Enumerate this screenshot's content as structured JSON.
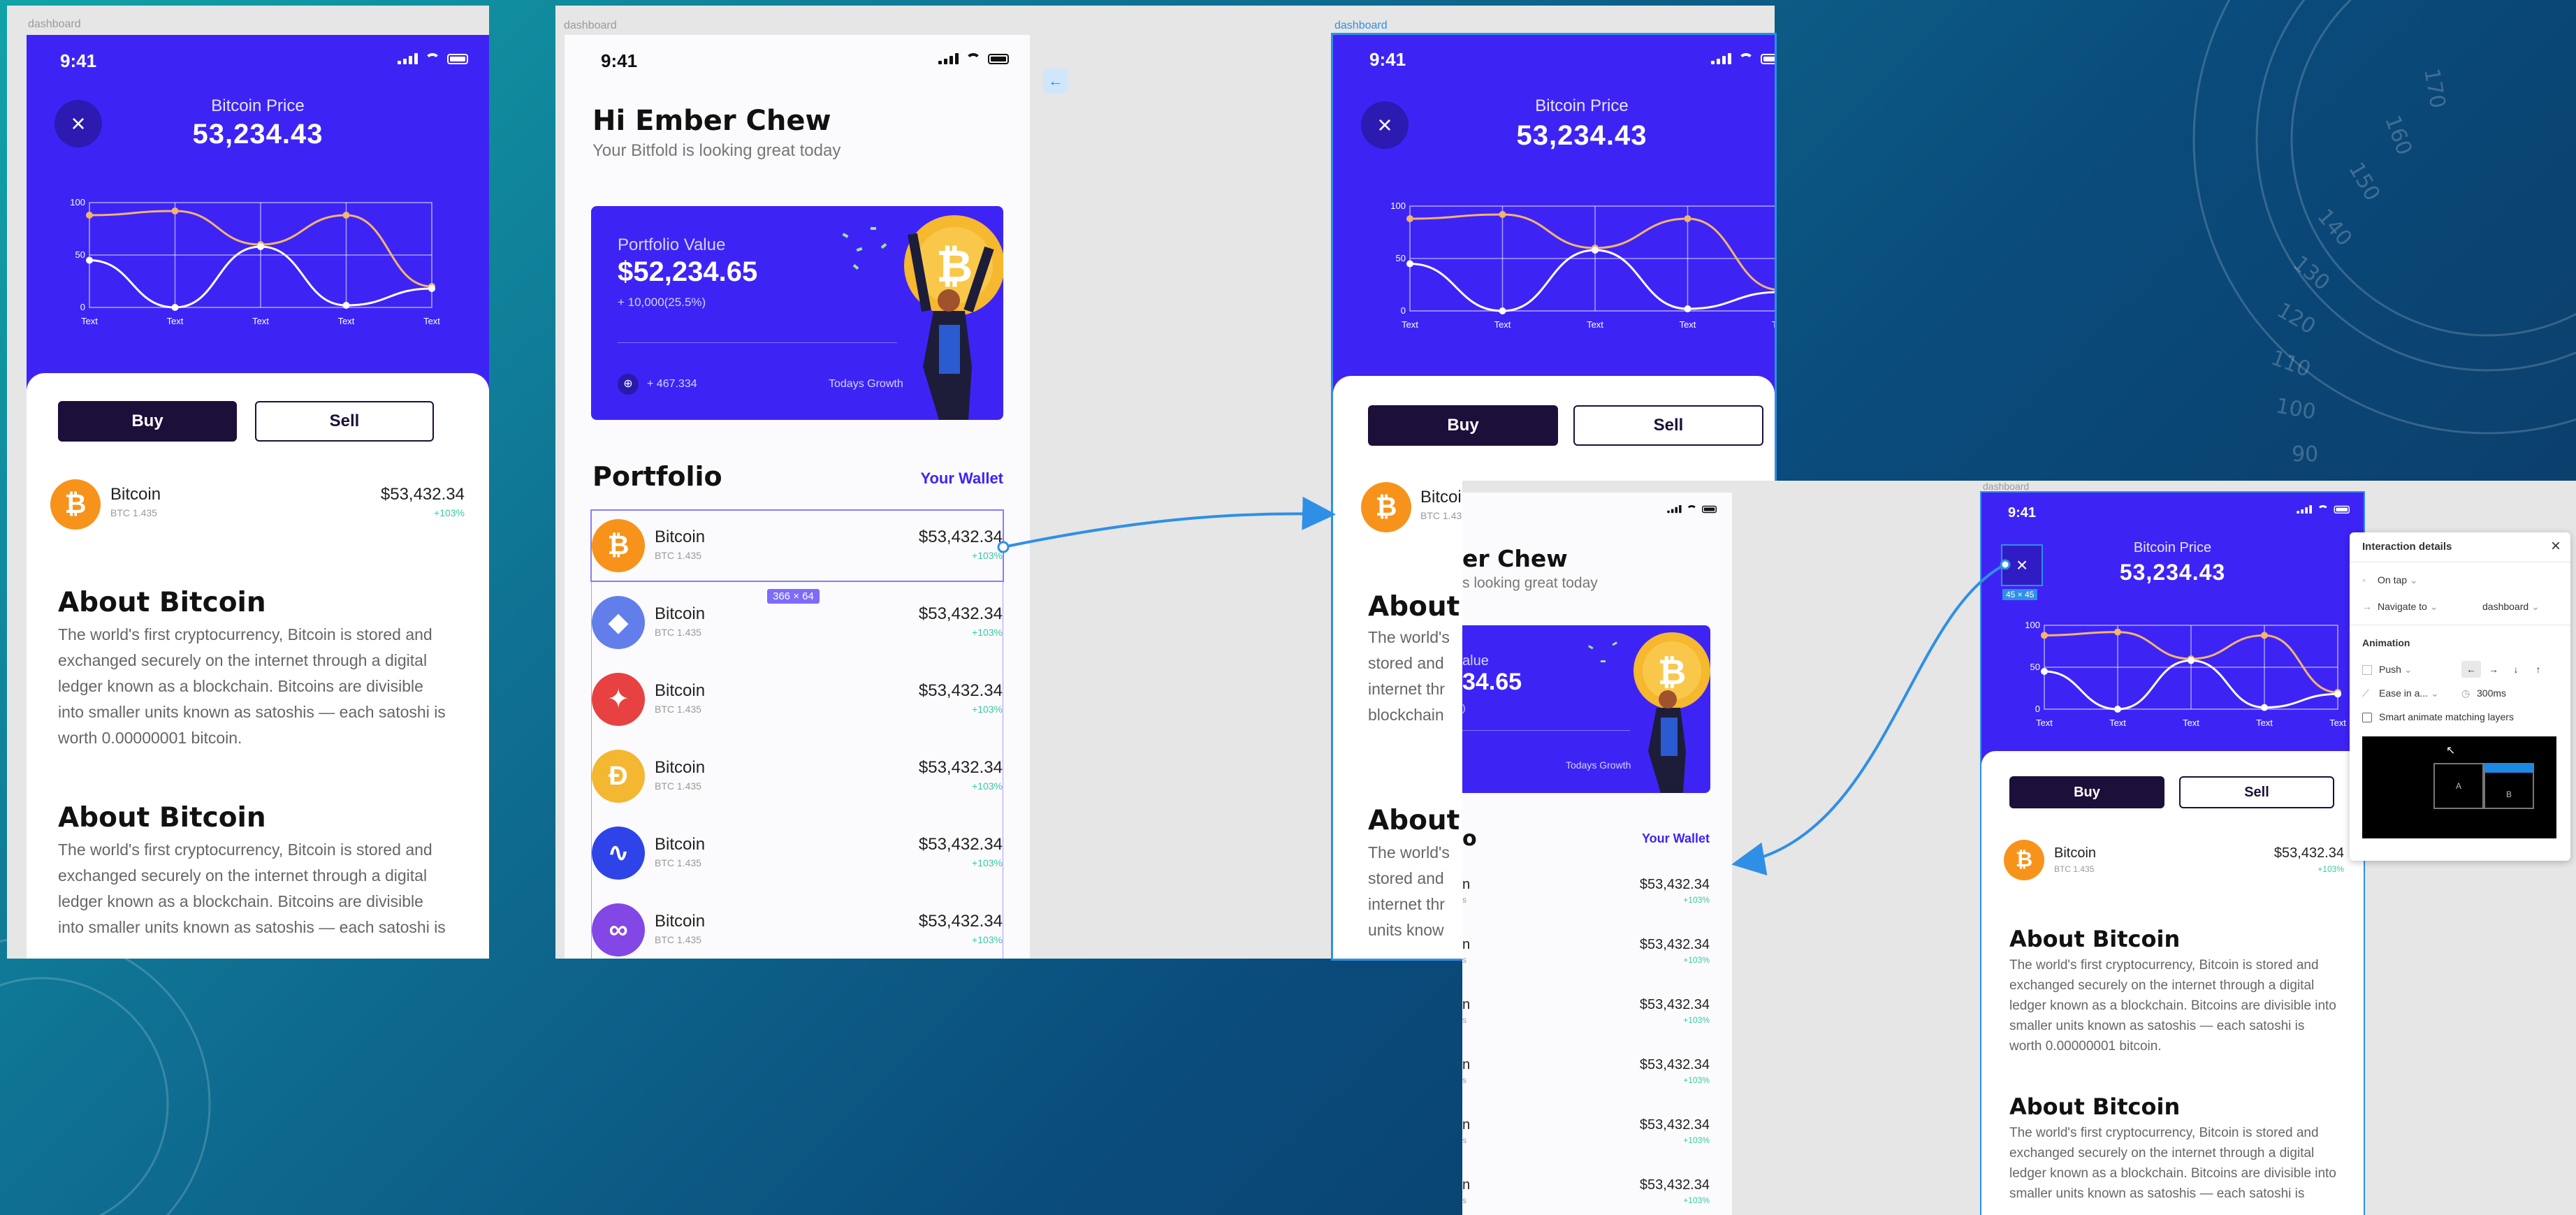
{
  "colors": {
    "accent": "#3d24f5",
    "dark": "#1c0f3a",
    "positive": "#36c9a3",
    "selection": "#2f8fe6"
  },
  "frame_labels": {
    "f1": "dashboard",
    "f2": "dashboard",
    "f3": "dashboard",
    "f5": "dashboard"
  },
  "status_time": "9:41",
  "price": {
    "label": "Bitcoin Price",
    "value": "53,234.43"
  },
  "chart_data": {
    "type": "line",
    "categories": [
      "Text",
      "Text",
      "Text",
      "Text",
      "Text"
    ],
    "ylim": [
      0,
      100
    ],
    "yticks": [
      "100",
      "50",
      "0"
    ],
    "series": [
      {
        "values": [
          88,
          92,
          60,
          88,
          20
        ]
      },
      {
        "values": [
          45,
          0,
          58,
          2,
          18
        ]
      }
    ]
  },
  "actions": {
    "buy": "Buy",
    "sell": "Sell"
  },
  "coin": {
    "name": "Bitcoin",
    "sub": "BTC 1.435",
    "amount": "$53,432.34",
    "change": "+103%"
  },
  "about": [
    {
      "title": "About Bitcoin",
      "body": "The world's first cryptocurrency, Bitcoin is stored and exchanged securely on the internet through a digital ledger known as a blockchain. Bitcoins are divisible into smaller units known as satoshis — each satoshi is worth 0.00000001 bitcoin."
    },
    {
      "title": "About Bitcoin",
      "body": "The world's first cryptocurrency, Bitcoin is stored and exchanged securely on the internet through a digital ledger known as a blockchain. Bitcoins are divisible into smaller units known as satoshis — each satoshi is"
    }
  ],
  "home": {
    "greeting": "Hi Ember Chew",
    "subtitle": "Your Bitfold is looking great today",
    "card": {
      "label": "Portfolio Value",
      "value": "$52,234.65",
      "change": "+ 10,000(25.5%)",
      "growth": "+ 467.334",
      "growth_label": "Todays Growth"
    },
    "portfolio_title": "Portfolio",
    "wallet_link": "Your Wallet",
    "size_badge": "366 × 64",
    "list": [
      {
        "name": "Bitcoin",
        "sub": "BTC 1.435",
        "amount": "$53,432.34",
        "change": "+103%",
        "color": "#f7931a",
        "glyph": "₿"
      },
      {
        "name": "Bitcoin",
        "sub": "BTC 1.435",
        "amount": "$53,432.34",
        "change": "+103%",
        "color": "#627eea",
        "glyph": "◆"
      },
      {
        "name": "Bitcoin",
        "sub": "BTC 1.435",
        "amount": "$53,432.34",
        "change": "+103%",
        "color": "#e84142",
        "glyph": "✦"
      },
      {
        "name": "Bitcoin",
        "sub": "BTC 1.435",
        "amount": "$53,432.34",
        "change": "+103%",
        "color": "#f4b731",
        "glyph": "Ð"
      },
      {
        "name": "Bitcoin",
        "sub": "BTC 1.435",
        "amount": "$53,432.34",
        "change": "+103%",
        "color": "#2f44e8",
        "glyph": "∿"
      },
      {
        "name": "Bitcoin",
        "sub": "BTC 1.435",
        "amount": "$53,432.34",
        "change": "+103%",
        "color": "#8247e5",
        "glyph": "∞"
      }
    ]
  },
  "partial": {
    "greeting": "er Chew",
    "subtitle": "s looking great today",
    "card_label": "alue",
    "card_value": "34.65",
    "card_change": ")",
    "growth_label": "Todays Growth",
    "wallet": "Your Wallet",
    "about1": "About",
    "about2": "About",
    "lines": [
      "The world's",
      "stored and",
      "internet thr",
      "blockchain",
      "units know"
    ],
    "row_letters": [
      "n",
      "n",
      "n",
      "n",
      "n",
      "n"
    ],
    "row_subs": [
      "s",
      "s",
      "s",
      "s",
      "s",
      "s"
    ]
  },
  "size_badge_small": "45 × 45",
  "interaction": {
    "title": "Interaction details",
    "trigger": "On tap",
    "action": "Navigate to",
    "destination": "dashboard",
    "animation_header": "Animation",
    "animation_type": "Push",
    "easing": "Ease in a...",
    "duration": "300ms",
    "smart_animate": "Smart animate matching layers",
    "preview_a": "A",
    "preview_b": "B",
    "directions": [
      "←",
      "→",
      "↓",
      "↑"
    ]
  },
  "dial_numbers": [
    "170",
    "160",
    "150",
    "140",
    "130",
    "120",
    "110",
    "100",
    "90"
  ]
}
